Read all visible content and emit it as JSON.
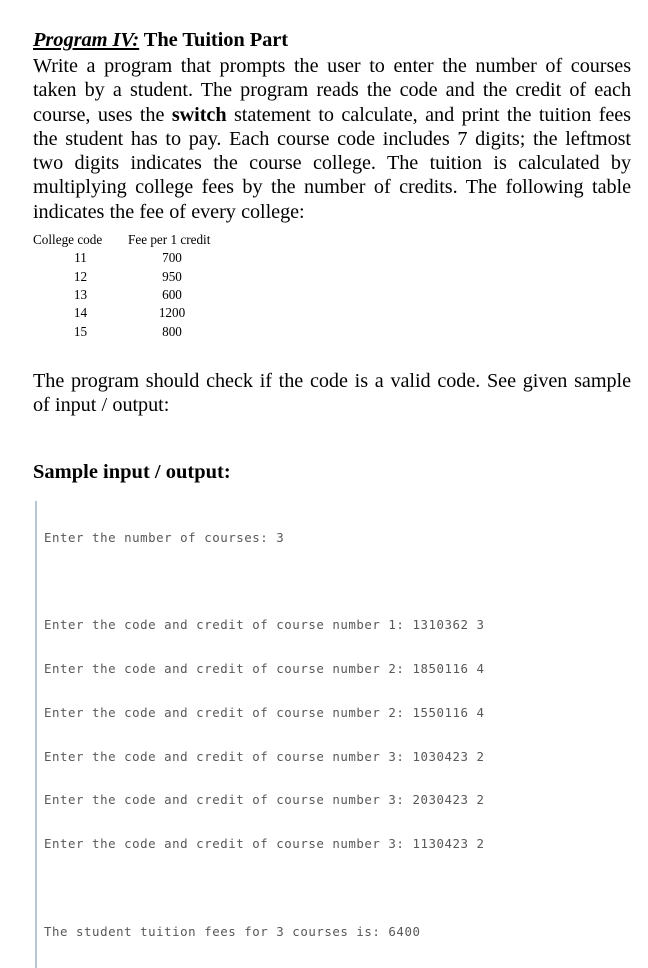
{
  "document": {
    "title": {
      "label": "Program IV:",
      "rest": " The Tuition Part"
    },
    "paragraphs": {
      "intro_before_switch": "Write a program that prompts the user to enter the number of courses taken by a student. The program reads the code and the credit of each course, uses the ",
      "switch_keyword": "switch",
      "intro_after_switch": " statement to calculate, and print the tuition fees the student has to pay. Each course code includes 7 digits; the leftmost two digits indicates the course college. The tuition is calculated by multiplying college fees by the number of credits. The following table indicates the fee of every college:",
      "check_code": "The program should check if the code is a valid code. See given sample of input / output:"
    },
    "fee_table": {
      "header_code": "College code",
      "header_fee": "Fee per 1 credit",
      "rows": [
        {
          "code": "11",
          "fee": "700"
        },
        {
          "code": "12",
          "fee": "950"
        },
        {
          "code": "13",
          "fee": "600"
        },
        {
          "code": "14",
          "fee": "1200"
        },
        {
          "code": "15",
          "fee": "800"
        }
      ]
    },
    "sample_heading": "Sample input / output:",
    "console": {
      "block_one": [
        "Enter the number of courses: 3"
      ],
      "block_two": [
        "Enter the code and credit of course number 1: 1310362 3",
        "Enter the code and credit of course number 2: 1850116 4",
        "Enter the code and credit of course number 2: 1550116 4",
        "Enter the code and credit of course number 3: 1030423 2",
        "Enter the code and credit of course number 3: 2030423 2",
        "Enter the code and credit of course number 3: 1130423 2"
      ],
      "block_three": [
        "The student tuition fees for 3 courses is: 6400"
      ]
    }
  },
  "colors": {
    "page_background": "#ffffff",
    "body_text": "#000000",
    "console_text": "#58585a",
    "console_rule": "#b9c6d2"
  }
}
